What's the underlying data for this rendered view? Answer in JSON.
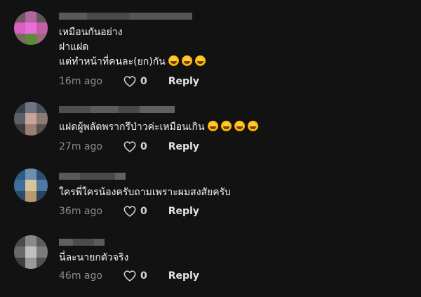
{
  "comments": [
    {
      "body": "เหมือนกันอย่าง\nฝาแฝด\nแต่ทำหน้าที่คนละ(ยก)กัน",
      "emoji": [
        "grinning-face-emoji",
        "grinning-face-emoji",
        "grinning-face-emoji"
      ],
      "time": "16m ago",
      "likes": "0",
      "reply_label": "Reply"
    },
    {
      "body": "แฝดผู้พลัดพรากรึป่าวค่ะเหมือนเกิน",
      "emoji": [
        "rolling-laughing-emoji",
        "rolling-laughing-emoji",
        "rolling-laughing-emoji",
        "rolling-laughing-emoji"
      ],
      "time": "27m ago",
      "likes": "0",
      "reply_label": "Reply"
    },
    {
      "body": "ใครพี่ใครน้องครับถามเพราะผมสงสัยครับ",
      "emoji": [],
      "time": "36m ago",
      "likes": "0",
      "reply_label": "Reply"
    },
    {
      "body": "นี่ละนายกตัวจริง",
      "emoji": [],
      "time": "46m ago",
      "likes": "0",
      "reply_label": "Reply"
    }
  ],
  "colors": {
    "background": "#121212",
    "timestamp": "#8e8e8e",
    "text": "#f2f2f2"
  }
}
